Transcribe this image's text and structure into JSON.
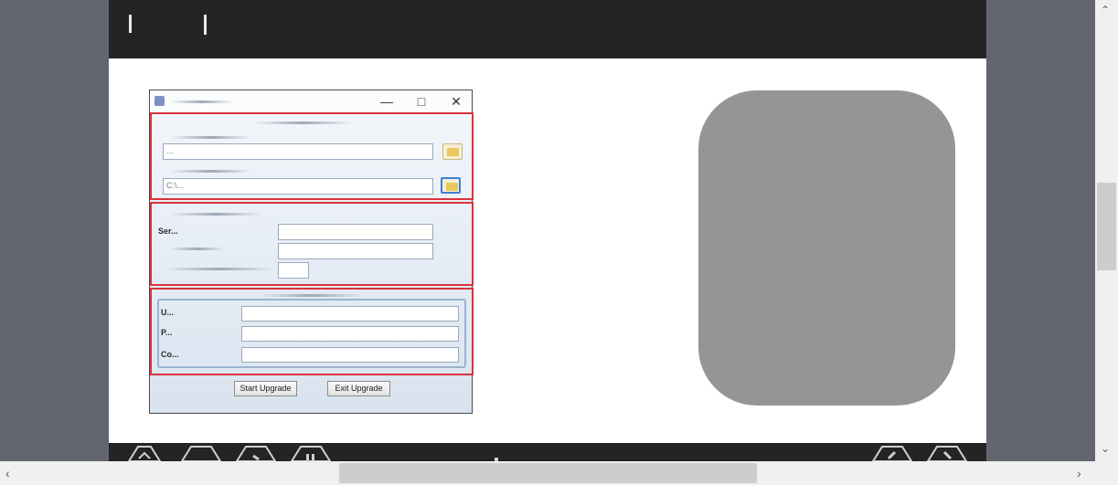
{
  "dialog": {
    "start_button_label": "Start Upgrade",
    "exit_button_label": "Exit Upgrade",
    "section1": {
      "path1_value": "...",
      "path2_value": "C:\\..."
    },
    "section2": {
      "label1": "Ser...",
      "field1_value": "",
      "field2_value": "",
      "field3_value": ""
    },
    "section3": {
      "label_user": "U...",
      "label_password": "P...",
      "label_confirm": "Co..."
    }
  },
  "colors": {
    "highlight_border": "#d9333b",
    "page_background": "#62656d",
    "card_fill": "#959595"
  },
  "scrollbars": {
    "up_arrow": "chevron-up-icon",
    "down_arrow": "chevron-down-icon",
    "left_arrow": "chevron-left-icon",
    "right_arrow": "chevron-right-icon"
  }
}
